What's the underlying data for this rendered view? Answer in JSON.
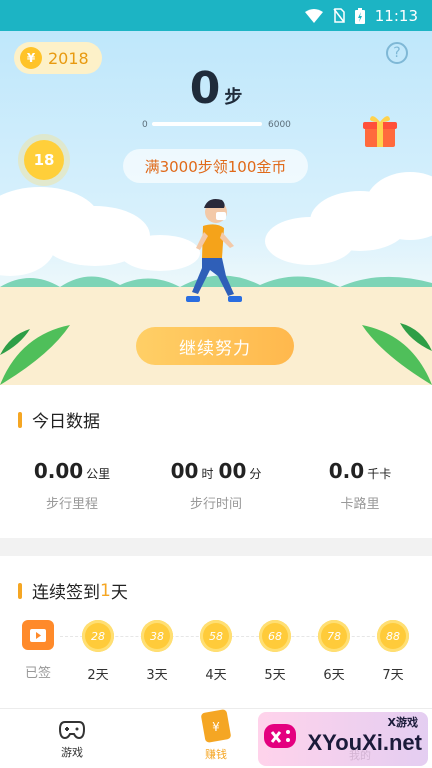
{
  "status": {
    "time": "11:13"
  },
  "header": {
    "coin_count": "2018",
    "help_symbol": "?"
  },
  "steps": {
    "value": "0",
    "unit": "步",
    "min_label": "0",
    "max_label": "6000",
    "progress": 0
  },
  "bubble_coin": "18",
  "reward_text": "满3000步领100金币",
  "continue_button": "继续努力",
  "today": {
    "title": "今日数据",
    "stats": [
      {
        "value": "0.00",
        "unit": "公里",
        "label": "步行里程"
      },
      {
        "value_h": "00",
        "unit_h": "时",
        "value_m": "00",
        "unit_m": "分",
        "label": "步行时间"
      },
      {
        "value": "0.0",
        "unit": "千卡",
        "label": "卡路里"
      }
    ]
  },
  "checkin": {
    "title_prefix": "连续签到",
    "title_count": "1",
    "title_suffix": "天",
    "days": [
      {
        "coin": "",
        "label": "已签"
      },
      {
        "coin": "28",
        "label": "2天"
      },
      {
        "coin": "38",
        "label": "3天"
      },
      {
        "coin": "58",
        "label": "4天"
      },
      {
        "coin": "68",
        "label": "5天"
      },
      {
        "coin": "78",
        "label": "6天"
      },
      {
        "coin": "88",
        "label": "7天"
      }
    ]
  },
  "nav": {
    "games": "游戏",
    "earn": "赚钱",
    "mine": "我的"
  },
  "watermark": {
    "main": "XYouXi.net",
    "small": "X游戏"
  },
  "colors": {
    "accent": "#f5a623",
    "status_bar": "#1cb4c4"
  }
}
